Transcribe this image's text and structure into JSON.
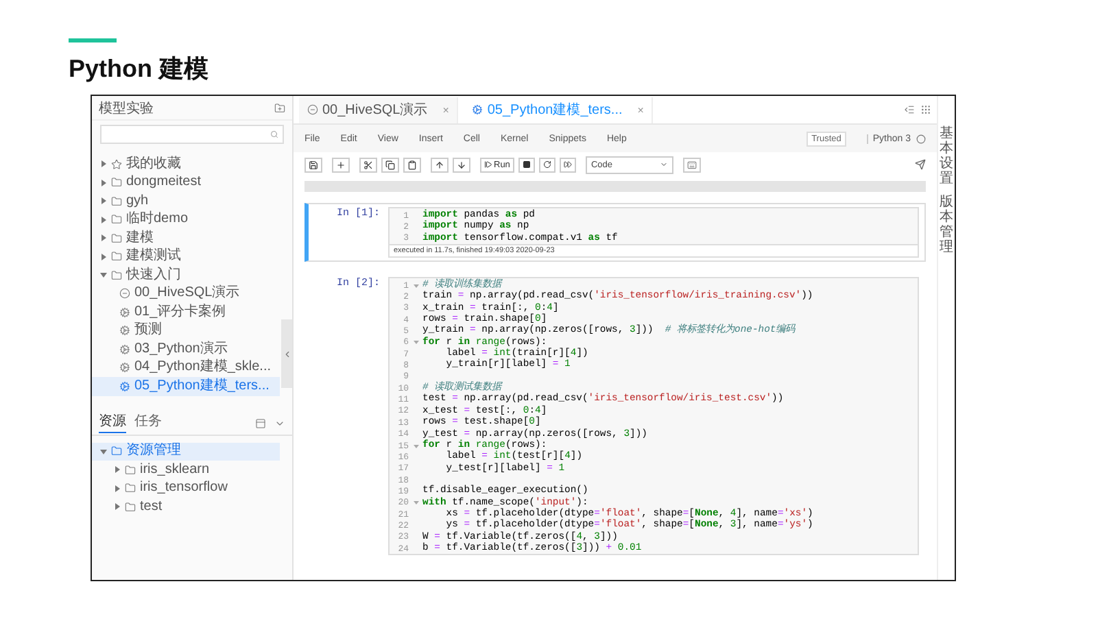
{
  "slide": {
    "title": "Python 建模"
  },
  "sidebar": {
    "title": "模型实验",
    "tree": [
      {
        "label": "我的收藏",
        "kind": "star",
        "expanded": false,
        "selected": false
      },
      {
        "label": "dongmeitest",
        "kind": "folder",
        "expanded": false,
        "selected": false
      },
      {
        "label": "gyh",
        "kind": "folder",
        "expanded": false,
        "selected": false
      },
      {
        "label": "临时demo",
        "kind": "folder",
        "expanded": false,
        "selected": false
      },
      {
        "label": "建模",
        "kind": "folder",
        "expanded": false,
        "selected": false
      },
      {
        "label": "建模测试",
        "kind": "folder",
        "expanded": false,
        "selected": false
      },
      {
        "label": "快速入门",
        "kind": "folder",
        "expanded": true,
        "selected": false,
        "children": [
          {
            "label": "00_HiveSQL演示",
            "kind": "sql",
            "selected": false
          },
          {
            "label": "01_评分卡案例",
            "kind": "notebook",
            "selected": false
          },
          {
            "label": "预测",
            "kind": "notebook",
            "selected": false
          },
          {
            "label": "03_Python演示",
            "kind": "notebook",
            "selected": false
          },
          {
            "label": "04_Python建模_skle...",
            "kind": "notebook",
            "selected": false
          },
          {
            "label": "05_Python建模_ters...",
            "kind": "notebook",
            "selected": true
          }
        ]
      }
    ],
    "panel_tabs": [
      {
        "label": "资源",
        "selected": true
      },
      {
        "label": "任务",
        "selected": false
      }
    ],
    "resources": [
      {
        "label": "资源管理",
        "expanded": true,
        "selected": true,
        "children": [
          {
            "label": "iris_sklearn",
            "expanded": false,
            "selected": false
          },
          {
            "label": "iris_tensorflow",
            "expanded": false,
            "selected": false
          },
          {
            "label": "test",
            "expanded": false,
            "selected": false
          }
        ]
      }
    ]
  },
  "notebook_tabs": [
    {
      "label": "00_HiveSQL演示",
      "kind": "sql",
      "selected": false,
      "close": "×"
    },
    {
      "label": "05_Python建模_ters...",
      "kind": "notebook",
      "selected": true,
      "close": "×"
    }
  ],
  "menu": [
    "File",
    "Edit",
    "View",
    "Insert",
    "Cell",
    "Kernel",
    "Snippets",
    "Help"
  ],
  "trusted": "Trusted",
  "kernel": "Python 3",
  "toolbar": {
    "run": "Run",
    "cell_type": "Code"
  },
  "cells": [
    {
      "prompt": "In [1]:",
      "selected": true,
      "note": "executed in 11.7s, finished 19:49:03 2020-09-23",
      "lines": [
        {
          "no": "1",
          "foldable": false,
          "tokens": [
            {
              "kind": "kw",
              "t": "import"
            },
            {
              "kind": "p",
              "t": " pandas "
            },
            {
              "kind": "kw",
              "t": "as"
            },
            {
              "kind": "p",
              "t": " pd"
            }
          ]
        },
        {
          "no": "2",
          "foldable": false,
          "tokens": [
            {
              "kind": "kw",
              "t": "import"
            },
            {
              "kind": "p",
              "t": " numpy "
            },
            {
              "kind": "kw",
              "t": "as"
            },
            {
              "kind": "p",
              "t": " np"
            }
          ]
        },
        {
          "no": "3",
          "foldable": false,
          "tokens": [
            {
              "kind": "kw",
              "t": "import"
            },
            {
              "kind": "p",
              "t": " tensorflow.compat.v1 "
            },
            {
              "kind": "kw",
              "t": "as"
            },
            {
              "kind": "p",
              "t": " tf"
            }
          ]
        }
      ]
    },
    {
      "prompt": "In [2]:",
      "selected": false,
      "lines": [
        {
          "no": "1",
          "foldable": true,
          "tokens": [
            {
              "kind": "c",
              "t": "# 读取训练集数据"
            }
          ]
        },
        {
          "no": "2",
          "foldable": false,
          "tokens": [
            {
              "kind": "p",
              "t": "train "
            },
            {
              "kind": "o",
              "t": "="
            },
            {
              "kind": "p",
              "t": " np.array(pd.read_csv("
            },
            {
              "kind": "s",
              "t": "'iris_tensorflow/iris_training.csv'"
            },
            {
              "kind": "p",
              "t": "))"
            }
          ]
        },
        {
          "no": "3",
          "foldable": false,
          "tokens": [
            {
              "kind": "p",
              "t": "x_train "
            },
            {
              "kind": "o",
              "t": "="
            },
            {
              "kind": "p",
              "t": " train[:, "
            },
            {
              "kind": "n",
              "t": "0"
            },
            {
              "kind": "p",
              "t": ":"
            },
            {
              "kind": "n",
              "t": "4"
            },
            {
              "kind": "p",
              "t": "]"
            }
          ]
        },
        {
          "no": "4",
          "foldable": false,
          "tokens": [
            {
              "kind": "p",
              "t": "rows "
            },
            {
              "kind": "o",
              "t": "="
            },
            {
              "kind": "p",
              "t": " train.shape["
            },
            {
              "kind": "n",
              "t": "0"
            },
            {
              "kind": "p",
              "t": "]"
            }
          ]
        },
        {
          "no": "5",
          "foldable": false,
          "tokens": [
            {
              "kind": "p",
              "t": "y_train "
            },
            {
              "kind": "o",
              "t": "="
            },
            {
              "kind": "p",
              "t": " np.array(np.zeros([rows, "
            },
            {
              "kind": "n",
              "t": "3"
            },
            {
              "kind": "p",
              "t": "]))  "
            },
            {
              "kind": "c",
              "t": "# 将标签转化为one-hot编码"
            }
          ]
        },
        {
          "no": "6",
          "foldable": true,
          "tokens": [
            {
              "kind": "kw",
              "t": "for"
            },
            {
              "kind": "p",
              "t": " r "
            },
            {
              "kind": "kw",
              "t": "in"
            },
            {
              "kind": "b",
              "t": " range"
            },
            {
              "kind": "p",
              "t": "(rows):"
            }
          ]
        },
        {
          "no": "7",
          "foldable": false,
          "tokens": [
            {
              "kind": "p",
              "t": "    label "
            },
            {
              "kind": "o",
              "t": "="
            },
            {
              "kind": "b",
              "t": " int"
            },
            {
              "kind": "p",
              "t": "(train[r]["
            },
            {
              "kind": "n",
              "t": "4"
            },
            {
              "kind": "p",
              "t": "])"
            }
          ]
        },
        {
          "no": "8",
          "foldable": false,
          "tokens": [
            {
              "kind": "p",
              "t": "    y_train[r][label] "
            },
            {
              "kind": "o",
              "t": "="
            },
            {
              "kind": "n",
              "t": " 1"
            }
          ]
        },
        {
          "no": "9",
          "foldable": false
        },
        {
          "no": "10",
          "foldable": false,
          "tokens": [
            {
              "kind": "c",
              "t": "# 读取测试集数据"
            }
          ]
        },
        {
          "no": "11",
          "foldable": false,
          "tokens": [
            {
              "kind": "p",
              "t": "test "
            },
            {
              "kind": "o",
              "t": "="
            },
            {
              "kind": "p",
              "t": " np.array(pd.read_csv("
            },
            {
              "kind": "s",
              "t": "'iris_tensorflow/iris_test.csv'"
            },
            {
              "kind": "p",
              "t": "))"
            }
          ]
        },
        {
          "no": "12",
          "foldable": false,
          "tokens": [
            {
              "kind": "p",
              "t": "x_test "
            },
            {
              "kind": "o",
              "t": "="
            },
            {
              "kind": "p",
              "t": " test[:, "
            },
            {
              "kind": "n",
              "t": "0"
            },
            {
              "kind": "p",
              "t": ":"
            },
            {
              "kind": "n",
              "t": "4"
            },
            {
              "kind": "p",
              "t": "]"
            }
          ]
        },
        {
          "no": "13",
          "foldable": false,
          "tokens": [
            {
              "kind": "p",
              "t": "rows "
            },
            {
              "kind": "o",
              "t": "="
            },
            {
              "kind": "p",
              "t": " test.shape["
            },
            {
              "kind": "n",
              "t": "0"
            },
            {
              "kind": "p",
              "t": "]"
            }
          ]
        },
        {
          "no": "14",
          "foldable": false,
          "tokens": [
            {
              "kind": "p",
              "t": "y_test "
            },
            {
              "kind": "o",
              "t": "="
            },
            {
              "kind": "p",
              "t": " np.array(np.zeros([rows, "
            },
            {
              "kind": "n",
              "t": "3"
            },
            {
              "kind": "p",
              "t": "]))"
            }
          ]
        },
        {
          "no": "15",
          "foldable": true,
          "tokens": [
            {
              "kind": "kw",
              "t": "for"
            },
            {
              "kind": "p",
              "t": " r "
            },
            {
              "kind": "kw",
              "t": "in"
            },
            {
              "kind": "b",
              "t": " range"
            },
            {
              "kind": "p",
              "t": "(rows):"
            }
          ]
        },
        {
          "no": "16",
          "foldable": false,
          "tokens": [
            {
              "kind": "p",
              "t": "    label "
            },
            {
              "kind": "o",
              "t": "="
            },
            {
              "kind": "b",
              "t": " int"
            },
            {
              "kind": "p",
              "t": "(test[r]["
            },
            {
              "kind": "n",
              "t": "4"
            },
            {
              "kind": "p",
              "t": "])"
            }
          ]
        },
        {
          "no": "17",
          "foldable": false,
          "tokens": [
            {
              "kind": "p",
              "t": "    y_test[r][label] "
            },
            {
              "kind": "o",
              "t": "="
            },
            {
              "kind": "n",
              "t": " 1"
            }
          ]
        },
        {
          "no": "18",
          "foldable": false
        },
        {
          "no": "19",
          "foldable": false,
          "tokens": [
            {
              "kind": "p",
              "t": "tf.disable_eager_execution()"
            }
          ]
        },
        {
          "no": "20",
          "foldable": true,
          "tokens": [
            {
              "kind": "kw",
              "t": "with"
            },
            {
              "kind": "p",
              "t": " tf.name_scope("
            },
            {
              "kind": "s",
              "t": "'input'"
            },
            {
              "kind": "p",
              "t": "):"
            }
          ]
        },
        {
          "no": "21",
          "foldable": false,
          "tokens": [
            {
              "kind": "p",
              "t": "    xs "
            },
            {
              "kind": "o",
              "t": "="
            },
            {
              "kind": "p",
              "t": " tf.placeholder(dtype"
            },
            {
              "kind": "o",
              "t": "="
            },
            {
              "kind": "s",
              "t": "'float'"
            },
            {
              "kind": "p",
              "t": ", shape"
            },
            {
              "kind": "o",
              "t": "="
            },
            {
              "kind": "p",
              "t": "["
            },
            {
              "kind": "kw",
              "t": "None"
            },
            {
              "kind": "p",
              "t": ", "
            },
            {
              "kind": "n",
              "t": "4"
            },
            {
              "kind": "p",
              "t": "], name"
            },
            {
              "kind": "o",
              "t": "="
            },
            {
              "kind": "s",
              "t": "'xs'"
            },
            {
              "kind": "p",
              "t": ")"
            }
          ]
        },
        {
          "no": "22",
          "foldable": false,
          "tokens": [
            {
              "kind": "p",
              "t": "    ys "
            },
            {
              "kind": "o",
              "t": "="
            },
            {
              "kind": "p",
              "t": " tf.placeholder(dtype"
            },
            {
              "kind": "o",
              "t": "="
            },
            {
              "kind": "s",
              "t": "'float'"
            },
            {
              "kind": "p",
              "t": ", shape"
            },
            {
              "kind": "o",
              "t": "="
            },
            {
              "kind": "p",
              "t": "["
            },
            {
              "kind": "kw",
              "t": "None"
            },
            {
              "kind": "p",
              "t": ", "
            },
            {
              "kind": "n",
              "t": "3"
            },
            {
              "kind": "p",
              "t": "], name"
            },
            {
              "kind": "o",
              "t": "="
            },
            {
              "kind": "s",
              "t": "'ys'"
            },
            {
              "kind": "p",
              "t": ")"
            }
          ]
        },
        {
          "no": "23",
          "foldable": false,
          "tokens": [
            {
              "kind": "p",
              "t": "W "
            },
            {
              "kind": "o",
              "t": "="
            },
            {
              "kind": "p",
              "t": " tf.Variable(tf.zeros(["
            },
            {
              "kind": "n",
              "t": "4"
            },
            {
              "kind": "p",
              "t": ", "
            },
            {
              "kind": "n",
              "t": "3"
            },
            {
              "kind": "p",
              "t": "]))"
            }
          ]
        },
        {
          "no": "24",
          "foldable": false,
          "tokens": [
            {
              "kind": "p",
              "t": "b "
            },
            {
              "kind": "o",
              "t": "="
            },
            {
              "kind": "p",
              "t": " tf.Variable(tf.zeros(["
            },
            {
              "kind": "n",
              "t": "3"
            },
            {
              "kind": "p",
              "t": "])) "
            },
            {
              "kind": "o",
              "t": "+"
            },
            {
              "kind": "n",
              "t": " 0.01"
            }
          ]
        }
      ]
    }
  ],
  "side_tabs": [
    "基本设置",
    "版本管理"
  ]
}
